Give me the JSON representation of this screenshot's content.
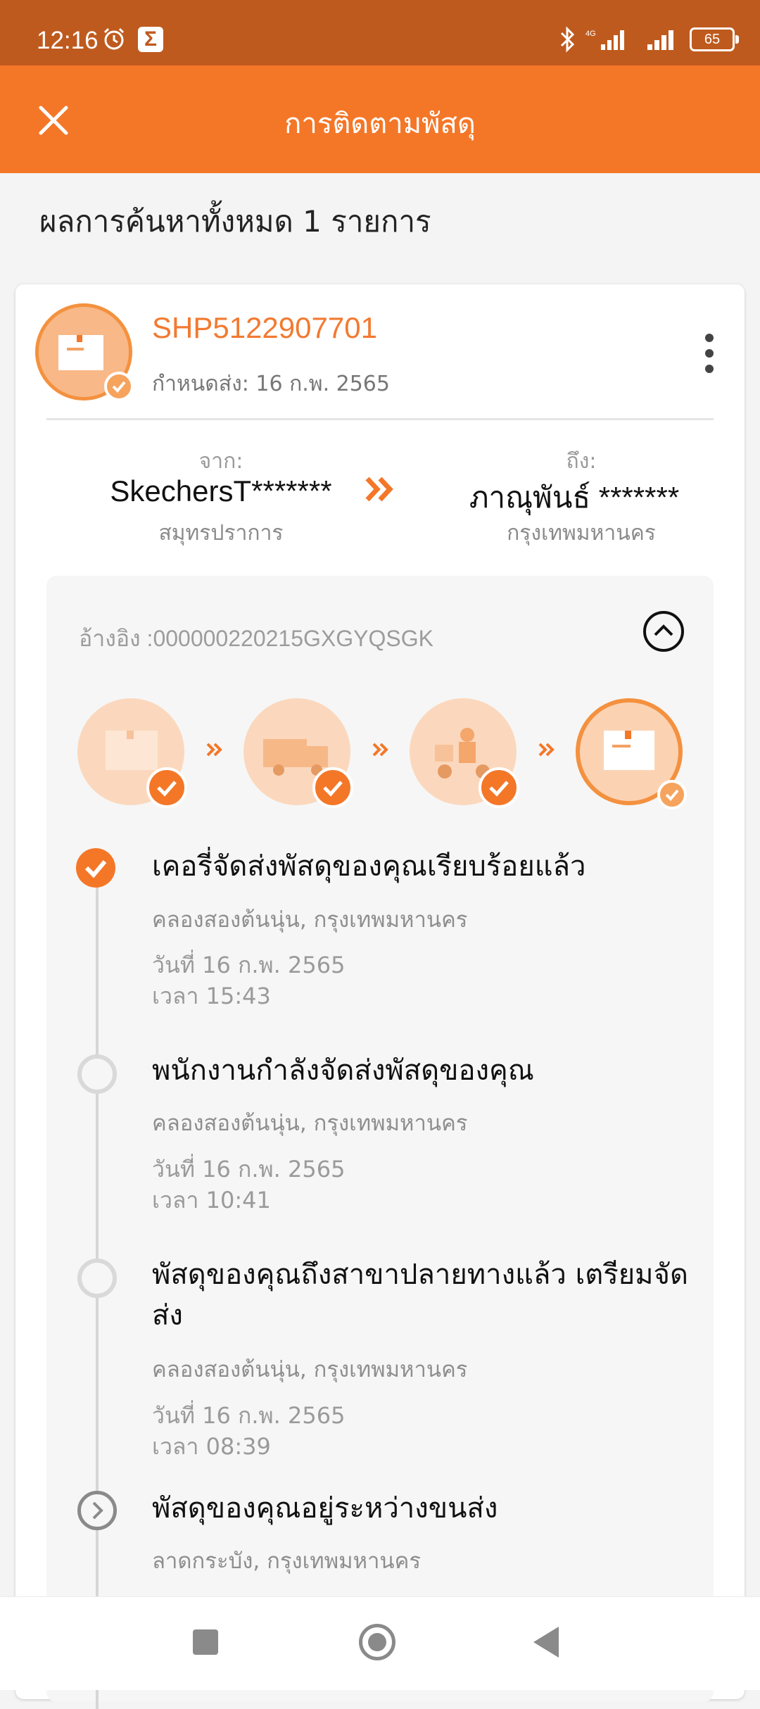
{
  "status_bar": {
    "time": "12:16",
    "battery": "65",
    "network": "4G"
  },
  "app_bar": {
    "title": "การติดตามพัสดุ",
    "close_icon": "close-icon"
  },
  "results_text": "ผลการค้นหาทั้งหมด 1 รายการ",
  "shipment": {
    "tracking_number": "SHP5122907701",
    "due_date": "กำหนดส่ง: 16 ก.พ. 2565",
    "from_label": "จาก:",
    "from_name": "SkechersT*******",
    "from_city": "สมุทรปราการ",
    "to_label": "ถึง:",
    "to_name": "ภาณุพันธ์ *******",
    "to_city": "กรุงเทพมหานคร",
    "reference": "อ้างอิง :000000220215GXGYQSGK",
    "progress_steps": [
      {
        "icon": "box-icon",
        "completed": true
      },
      {
        "icon": "truck-icon",
        "completed": true
      },
      {
        "icon": "delivery-scooter-icon",
        "completed": true
      },
      {
        "icon": "package-delivered-icon",
        "completed": true
      }
    ],
    "events": [
      {
        "title": "เคอรี่จัดส่งพัสดุของคุณเรียบร้อยแล้ว",
        "location": "คลองสองต้นนุ่น, กรุงเทพมหานคร",
        "date": "วันที่ 16 ก.พ. 2565",
        "time": "เวลา 15:43"
      },
      {
        "title": "พนักงานกำลังจัดส่งพัสดุของคุณ",
        "location": "คลองสองต้นนุ่น, กรุงเทพมหานคร",
        "date": "วันที่ 16 ก.พ. 2565",
        "time": "เวลา 10:41"
      },
      {
        "title": "พัสดุของคุณถึงสาขาปลายทางแล้ว เตรียมจัดส่ง",
        "location": "คลองสองต้นนุ่น, กรุงเทพมหานคร",
        "date": "วันที่ 16 ก.พ. 2565",
        "time": "เวลา 08:39"
      },
      {
        "title": "พัสดุของคุณอยู่ระหว่างขนส่ง",
        "location": "ลาดกระบัง, กรุงเทพมหานคร"
      }
    ]
  },
  "colors": {
    "accent": "#f47728",
    "status_bar": "#bf5a1e",
    "tracking_number": "#f27a31"
  }
}
